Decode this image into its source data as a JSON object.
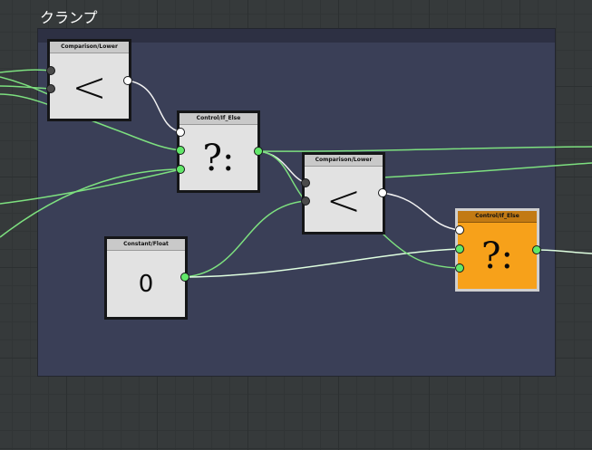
{
  "canvas": {
    "group_title": "クランプ"
  },
  "nodes": {
    "compare1": {
      "title": "Comparison/Lower",
      "symbol": "<"
    },
    "ifelse1": {
      "title": "Control/If_Else",
      "symbol": "?:"
    },
    "compare2": {
      "title": "Comparison/Lower",
      "symbol": "<"
    },
    "const1": {
      "title": "Constant/Float",
      "symbol": "0"
    },
    "ifelse2": {
      "title": "Control/If_Else",
      "symbol": "?:"
    }
  },
  "colors": {
    "wire_green": "#7de07f",
    "wire_white": "#f2f2f2",
    "port_green": "#62e86a",
    "selected_node": "#f7a11a",
    "group_fill": "#3a3f57"
  }
}
